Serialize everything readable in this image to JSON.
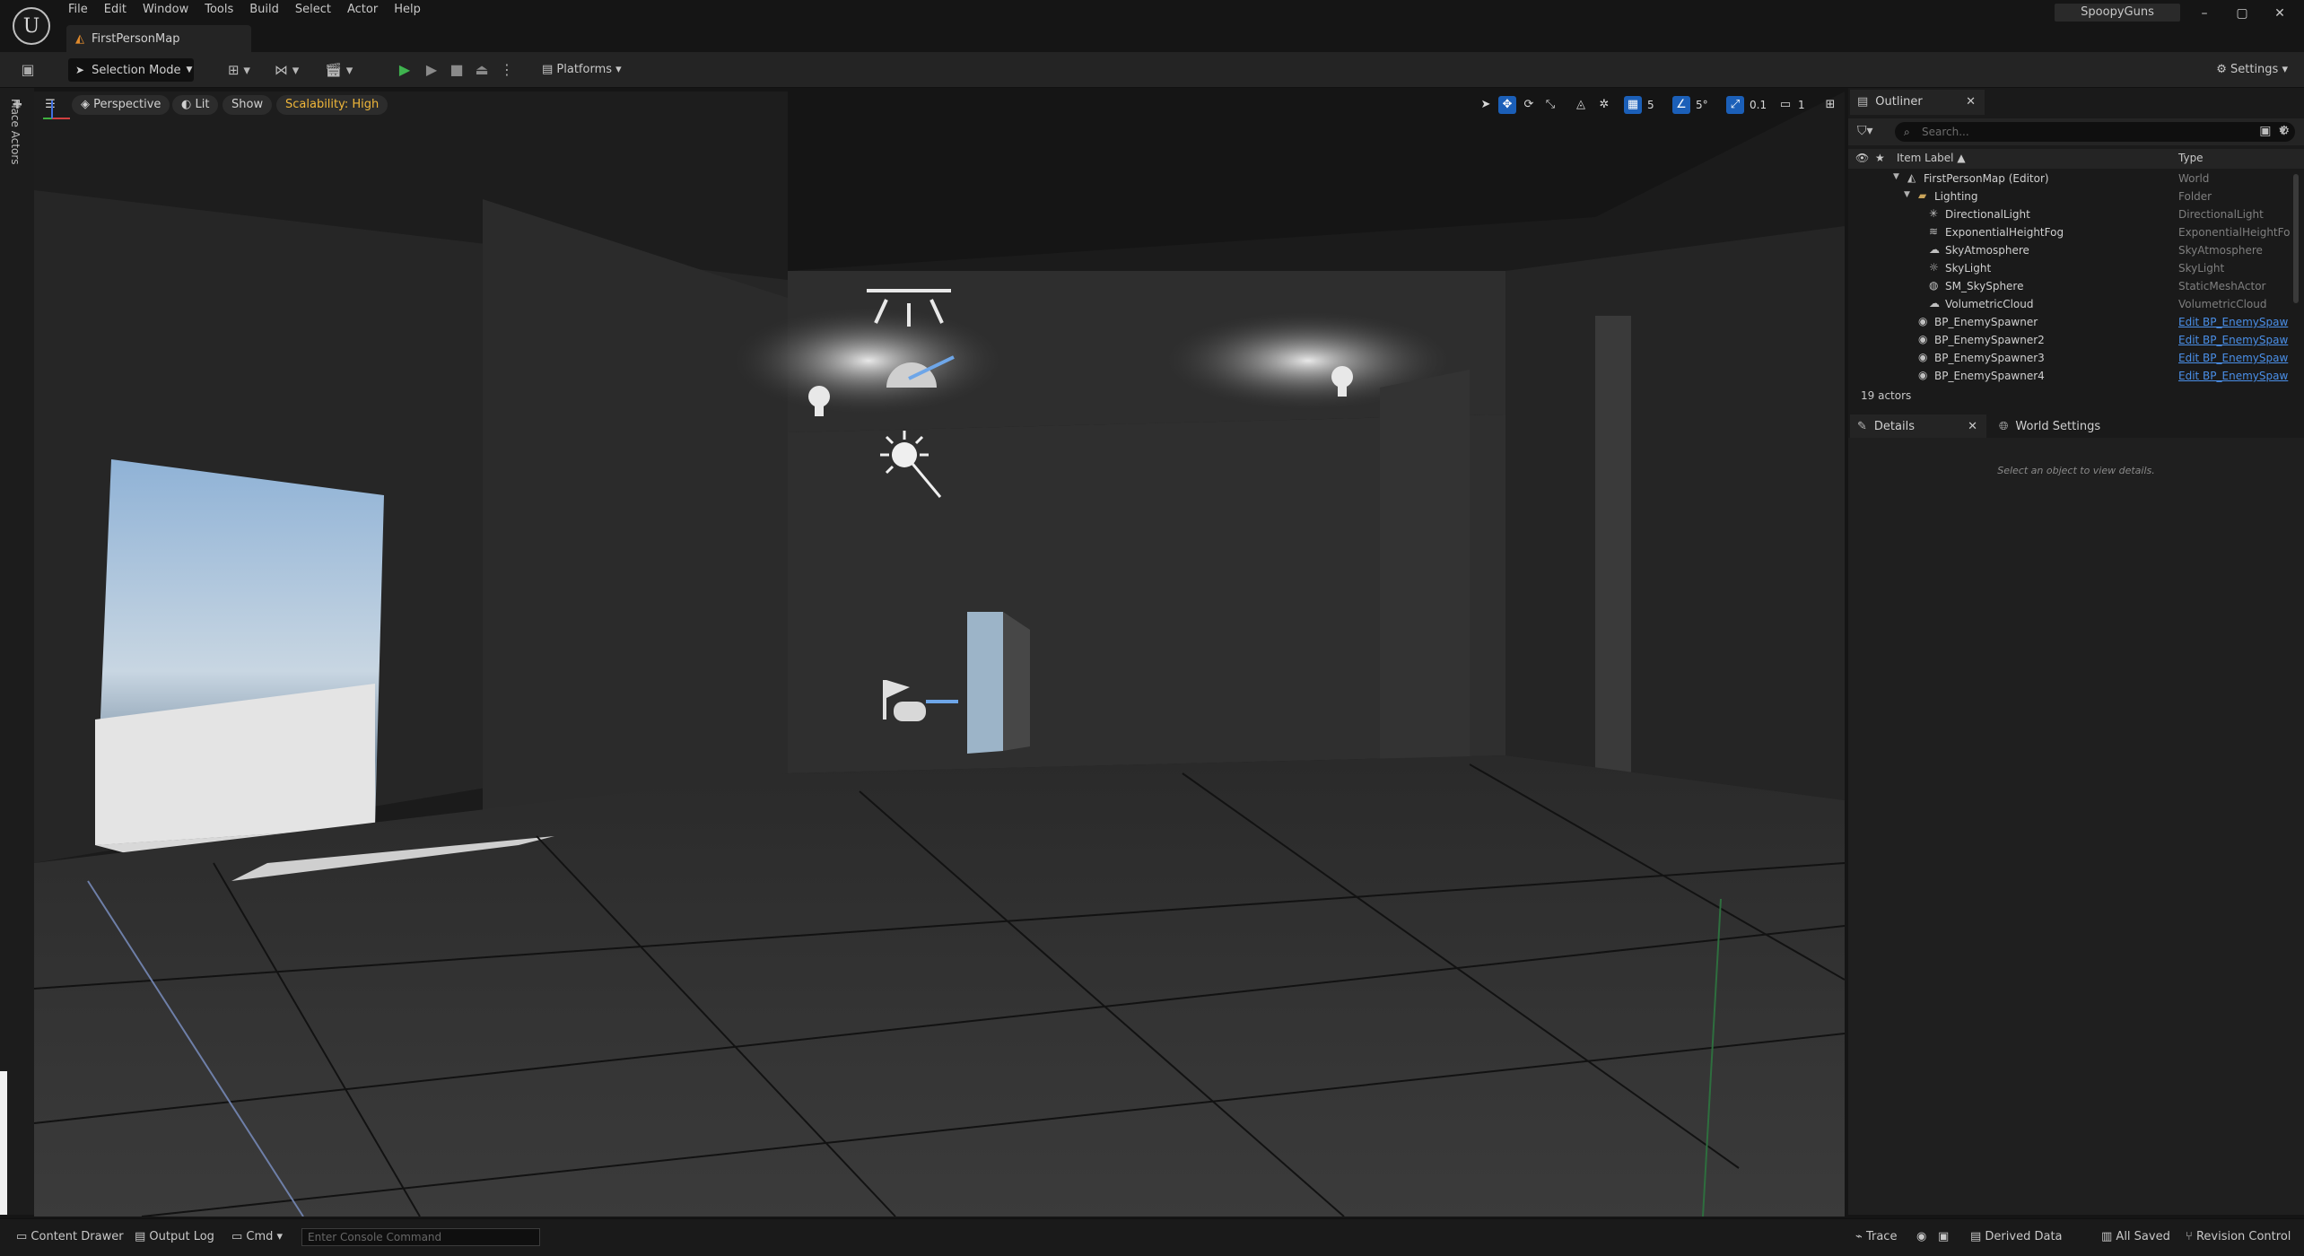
{
  "app": {
    "logo": "U",
    "project_name": "SpoopyGuns",
    "menu": [
      "File",
      "Edit",
      "Window",
      "Tools",
      "Build",
      "Select",
      "Actor",
      "Help"
    ],
    "window_controls": {
      "minimize": "–",
      "maximize": "▢",
      "close": "✕"
    }
  },
  "document_tab": {
    "label": "FirstPersonMap"
  },
  "toolbar": {
    "mode": "Selection Mode",
    "platforms": "Platforms",
    "settings": "Settings"
  },
  "left_strip": {
    "place_actors": "Place Actors"
  },
  "viewport": {
    "perspective": "Perspective",
    "view_mode": "Lit",
    "show": "Show",
    "scalability": "Scalability: High",
    "grid_snap": "5",
    "rotation_snap": "5°",
    "scale_snap": "0.1",
    "camera_speed": "1"
  },
  "outliner": {
    "tab_label": "Outliner",
    "search_placeholder": "Search...",
    "col_label": "Item Label",
    "col_type": "Type",
    "rows": [
      {
        "label": "FirstPersonMap (Editor)",
        "type": "World",
        "indent": 0,
        "expanded": true,
        "icon": "world-icon"
      },
      {
        "label": "Lighting",
        "type": "Folder",
        "indent": 1,
        "expanded": true,
        "icon": "folder-icon"
      },
      {
        "label": "DirectionalLight",
        "type": "DirectionalLight",
        "indent": 2,
        "icon": "directional-light-icon"
      },
      {
        "label": "ExponentialHeightFog",
        "type": "ExponentialHeightFog",
        "indent": 2,
        "icon": "fog-icon"
      },
      {
        "label": "SkyAtmosphere",
        "type": "SkyAtmosphere",
        "indent": 2,
        "icon": "sky-atmosphere-icon"
      },
      {
        "label": "SkyLight",
        "type": "SkyLight",
        "indent": 2,
        "icon": "sky-light-icon"
      },
      {
        "label": "SM_SkySphere",
        "type": "StaticMeshActor",
        "indent": 2,
        "icon": "static-mesh-icon"
      },
      {
        "label": "VolumetricCloud",
        "type": "VolumetricCloud",
        "indent": 2,
        "icon": "cloud-icon"
      },
      {
        "label": "BP_EnemySpawner",
        "type": "Edit BP_EnemySpaw",
        "indent": 1,
        "link": true,
        "icon": "blueprint-icon"
      },
      {
        "label": "BP_EnemySpawner2",
        "type": "Edit BP_EnemySpaw",
        "indent": 1,
        "link": true,
        "icon": "blueprint-icon"
      },
      {
        "label": "BP_EnemySpawner3",
        "type": "Edit BP_EnemySpaw",
        "indent": 1,
        "link": true,
        "icon": "blueprint-icon"
      },
      {
        "label": "BP_EnemySpawner4",
        "type": "Edit BP_EnemySpaw",
        "indent": 1,
        "link": true,
        "icon": "blueprint-icon"
      }
    ],
    "actor_count": "19 actors"
  },
  "details": {
    "tab_label": "Details",
    "world_settings_label": "World Settings",
    "empty_message": "Select an object to view details."
  },
  "statusbar": {
    "content_drawer": "Content Drawer",
    "output_log": "Output Log",
    "cmd": "Cmd",
    "console_placeholder": "Enter Console Command",
    "trace": "Trace",
    "derived_data": "Derived Data",
    "all_saved": "All Saved",
    "revision_control": "Revision Control"
  },
  "colors": {
    "accent_blue": "#1b5fb8",
    "play_green": "#3fb34f",
    "scalability_yellow": "#f0b73a",
    "link_blue": "#4a8fe8"
  }
}
